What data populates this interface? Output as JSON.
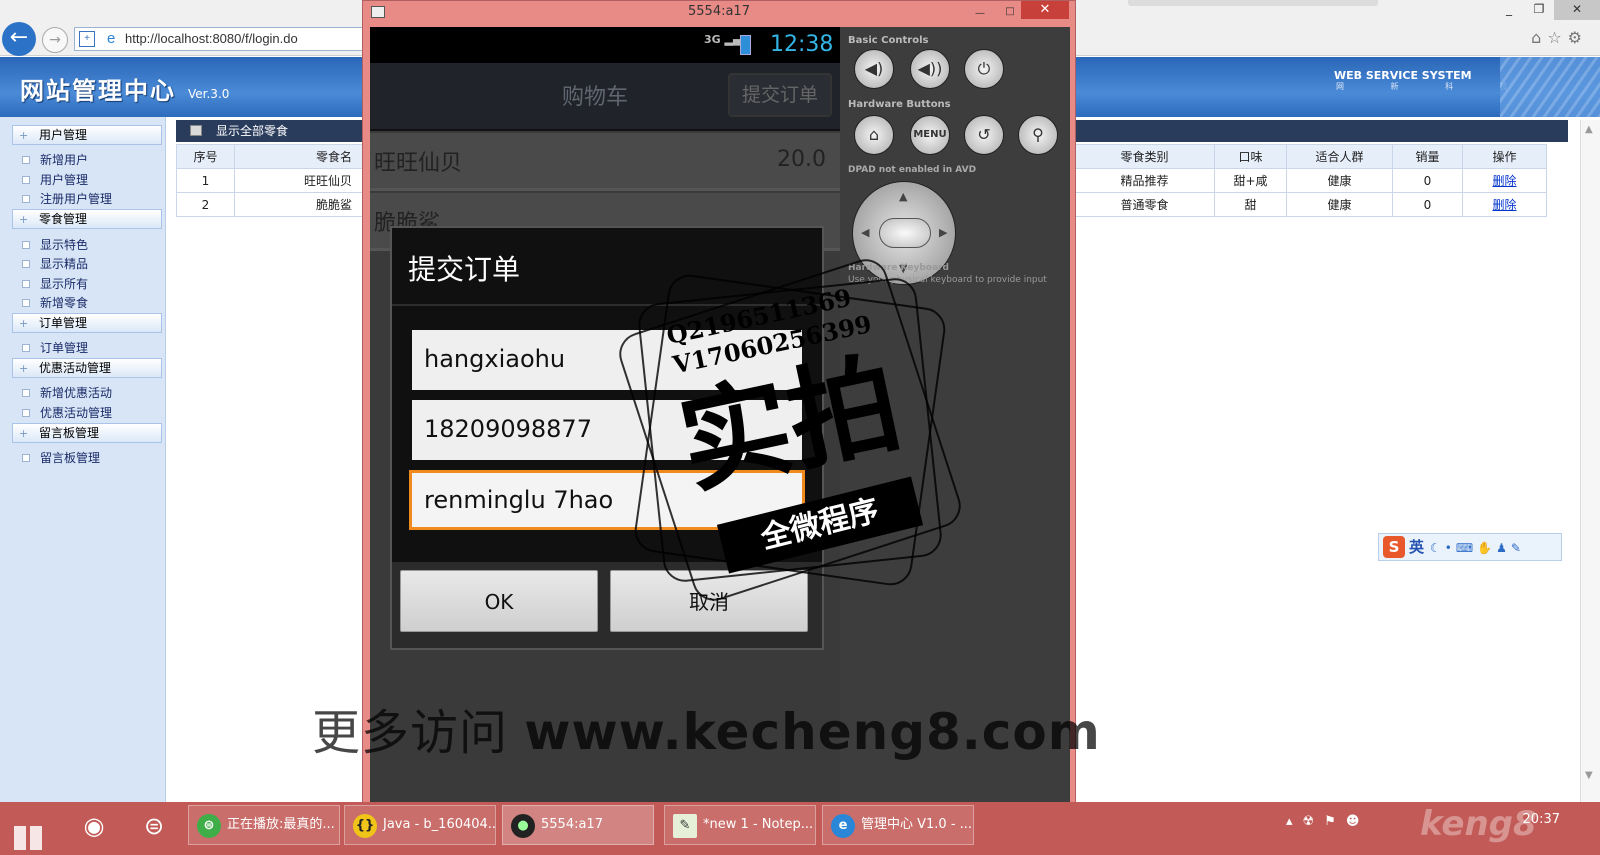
{
  "browser": {
    "url": "http://localhost:8080/f/login.do",
    "window_buttons": [
      "_",
      "❐",
      "✕"
    ]
  },
  "site": {
    "title": "网站管理中心",
    "version": "Ver.3.0",
    "badge": "WEB SERVICE SYSTEM",
    "badge_sub": "网 新 科 技"
  },
  "sidebar": {
    "groups": [
      {
        "label": "用户管理",
        "items": [
          "新增用户",
          "用户管理",
          "注册用户管理"
        ]
      },
      {
        "label": "零食管理",
        "items": [
          "显示特色",
          "显示精品",
          "显示所有",
          "新增零食"
        ]
      },
      {
        "label": "订单管理",
        "items": [
          "订单管理"
        ]
      },
      {
        "label": "优惠活动管理",
        "items": [
          "新增优惠活动",
          "优惠活动管理"
        ]
      },
      {
        "label": "留言板管理",
        "items": [
          "留言板管理"
        ]
      }
    ]
  },
  "main": {
    "section_title": "显示全部零食",
    "table": {
      "headers": [
        "序号",
        "零食名",
        "零食类别",
        "口味",
        "适合人群",
        "销量",
        "操作"
      ],
      "rows": [
        [
          "1",
          "旺旺仙贝",
          "精品推荐",
          "甜+咸",
          "健康",
          "0",
          "删除"
        ],
        [
          "2",
          "脆脆鲨",
          "普通零食",
          "甜",
          "健康",
          "0",
          "删除"
        ]
      ]
    }
  },
  "emulator": {
    "window_title": "5554:a17",
    "status": {
      "network": "3G",
      "time": "12:38"
    },
    "app": {
      "title": "购物车",
      "submit_label": "提交订单",
      "cart": [
        {
          "name": "旺旺仙贝",
          "price": "20.0"
        },
        {
          "name": "脆脆鲨",
          "price": ""
        }
      ]
    },
    "dialog": {
      "title": "提交订单",
      "name_value": "hangxiaohu",
      "phone_value": "18209098877",
      "address_value": "renminglu 7hao",
      "ok_label": "OK",
      "cancel_label": "取消"
    },
    "controls": {
      "basic_label": "Basic Controls",
      "hardware_label": "Hardware Buttons",
      "menu_label": "MENU",
      "dpad_label": "DPAD not enabled in AVD",
      "keyboard_label": "Hardware Keyboard",
      "keyboard_sub": "Use your physical keyboard to provide input"
    }
  },
  "watermark": {
    "stamp_contact_1": "Q2196511369",
    "stamp_contact_2": "V17060256399",
    "stamp_main": "实拍",
    "stamp_ribbon": "全微程序",
    "bottom_prefix": "更多访问",
    "bottom_site": "www.kecheng8.com"
  },
  "ime": {
    "lang": "英"
  },
  "taskbar": {
    "apps": [
      {
        "label": "正在播放:最真的..."
      },
      {
        "label": "Java - b_160404..."
      },
      {
        "label": "5554:a17"
      },
      {
        "label": "*new 1 - Notep..."
      },
      {
        "label": "管理中心 V1.0 - ..."
      }
    ],
    "clock": "20:37"
  },
  "colors": {
    "header_blue": "#2a66b8",
    "emulator_frame": "#e88a86",
    "taskbar": "#c25b57",
    "dialog_focus": "#f08a1c",
    "status_time": "#33b5e5"
  }
}
